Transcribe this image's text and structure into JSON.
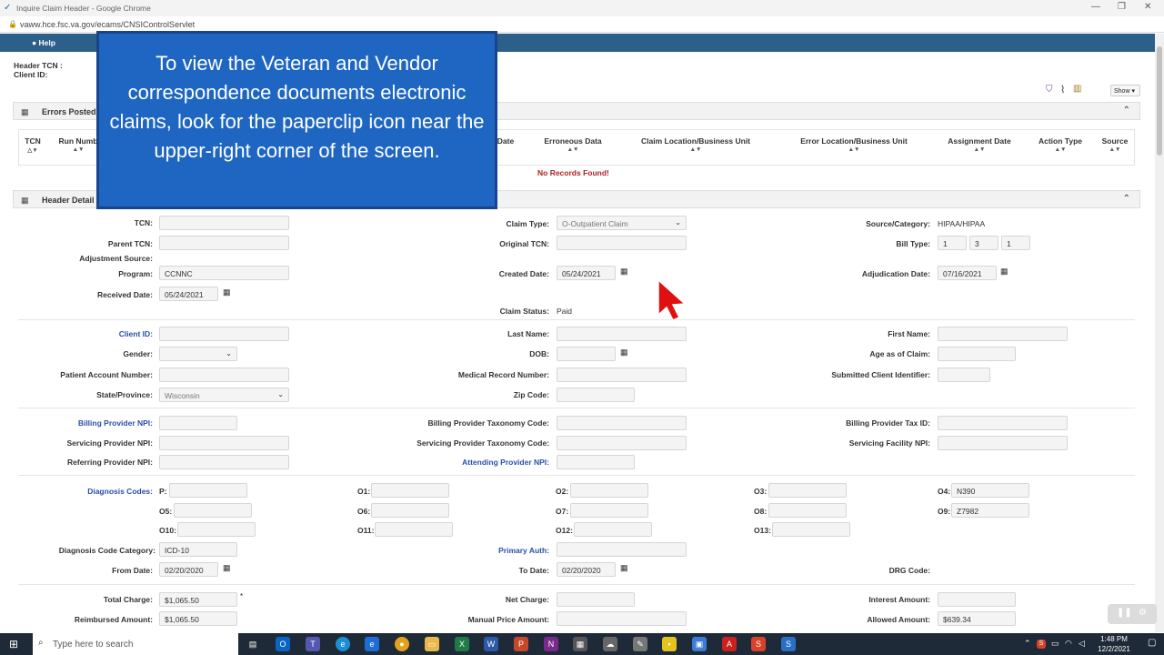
{
  "window": {
    "title": "Inquire Claim Header - Google Chrome",
    "url": "vaww.hce.fsc.va.gov/ecams/CNSIControlServlet",
    "controls": [
      "—",
      "❐",
      "✕"
    ]
  },
  "appbar": {
    "help": "Help"
  },
  "header_info": {
    "tcn_label": "Header TCN :",
    "client_label": "Client ID:",
    "show_label": "Show ▾"
  },
  "errors_panel": {
    "title": "Errors Posted",
    "columns": [
      "TCN",
      "Run Numb",
      "Date",
      "Erroneous Data",
      "Claim Location/Business Unit",
      "Error Location/Business Unit",
      "Assignment Date",
      "Action Type",
      "Source"
    ],
    "empty": "No Records Found!"
  },
  "overlay": {
    "text": "To view the Veteran and Vendor correspondence documents electronic claims, look for the paperclip icon near the upper-right corner of the screen."
  },
  "details_panel": {
    "title": "Header Detail"
  },
  "fields": {
    "tcn": "TCN:",
    "parent_tcn": "Parent TCN:",
    "adjustment_source": "Adjustment Source:",
    "program": "Program:",
    "program_val": "CCNNC",
    "received_date": "Received Date:",
    "received_date_val": "05/24/2021",
    "claim_type": "Claim Type:",
    "claim_type_val": "O-Outpatient Claim",
    "original_tcn": "Original TCN:",
    "created_date": "Created Date:",
    "created_date_val": "05/24/2021",
    "claim_status": "Claim Status:",
    "claim_status_val": "Paid",
    "source_category": "Source/Category:",
    "source_category_val": "HIPAA/HIPAA",
    "bill_type": "Bill Type:",
    "bill_type_vals": [
      "1",
      "3",
      "1"
    ],
    "adjudication_date": "Adjudication Date:",
    "adjudication_date_val": "07/16/2021",
    "client_id": "Client ID:",
    "gender": "Gender:",
    "patient_account": "Patient Account Number:",
    "state": "State/Province:",
    "state_val": "Wisconsin",
    "last_name": "Last Name:",
    "dob": "DOB:",
    "medical_record": "Medical Record Number:",
    "zip": "Zip Code:",
    "first_name": "First Name:",
    "age_claim": "Age as of Claim:",
    "submitted_client": "Submitted Client Identifier:",
    "billing_npi": "Billing Provider NPI:",
    "servicing_npi": "Servicing Provider NPI:",
    "referring_npi": "Referring Provider NPI:",
    "billing_taxonomy": "Billing Provider Taxonomy Code:",
    "servicing_taxonomy": "Servicing Provider Taxonomy Code:",
    "attending_npi": "Attending Provider NPI:",
    "billing_tax_id": "Billing Provider Tax ID:",
    "servicing_facility_npi": "Servicing Facility NPI:",
    "diagnosis_codes": "Diagnosis Codes:",
    "dx_p": "P:",
    "dx_o1": "O1:",
    "dx_o2": "O2:",
    "dx_o3": "O3:",
    "dx_o4": "O4:",
    "dx_o4_val": "N390",
    "dx_o5": "O5:",
    "dx_o6": "O6:",
    "dx_o7": "O7:",
    "dx_o8": "O8:",
    "dx_o9": "O9:",
    "dx_o9_val": "Z7982",
    "dx_o10": "O10:",
    "dx_o11": "O11:",
    "dx_o12": "O12:",
    "dx_o13": "O13:",
    "dx_category": "Diagnosis Code Category:",
    "dx_category_val": "ICD-10",
    "primary_auth": "Primary Auth:",
    "from_date": "From Date:",
    "from_date_val": "02/20/2020",
    "to_date": "To Date:",
    "to_date_val": "02/20/2020",
    "drg_code": "DRG Code:",
    "total_charge": "Total Charge:",
    "total_charge_val": "$1,065.50",
    "reimbursed_amount": "Reimbursed Amount:",
    "reimbursed_amount_val": "$1,065.50",
    "net_charge": "Net Charge:",
    "manual_price": "Manual Price Amount:",
    "interest_amount": "Interest Amount:",
    "allowed_amount": "Allowed Amount:",
    "allowed_amount_val": "$639.34"
  },
  "taskbar": {
    "search_placeholder": "Type here to search",
    "time": "1:48 PM",
    "date": "12/2/2021"
  }
}
